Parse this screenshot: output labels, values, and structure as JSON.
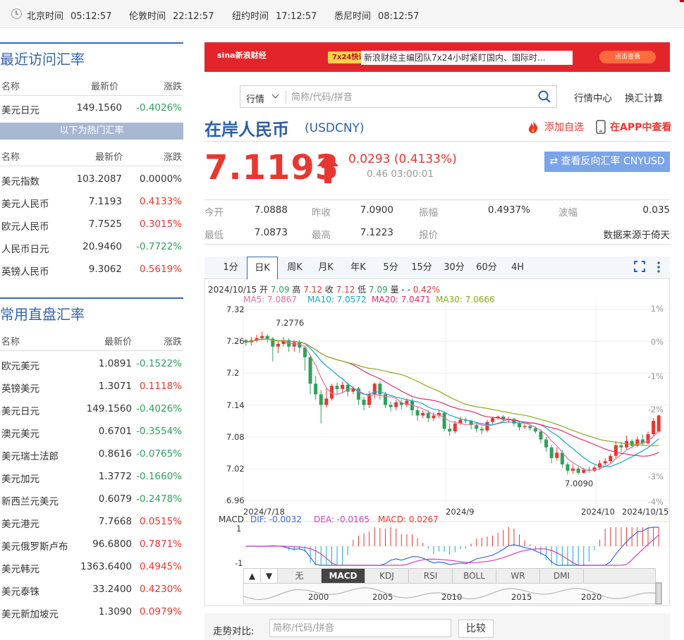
{
  "clocks": [
    {
      "label": "北京时间",
      "time": "05:12:57"
    },
    {
      "label": "伦敦时间",
      "time": "22:12:57"
    },
    {
      "label": "纽约时间",
      "time": "17:12:57"
    },
    {
      "label": "悉尼时间",
      "time": "08:12:57"
    }
  ],
  "recent": {
    "title": "最近访问汇率",
    "headers": [
      "名称",
      "最新价",
      "涨跌"
    ],
    "rows": [
      {
        "name": "美元日元",
        "price": "149.1560",
        "chg": "-0.4026%"
      }
    ]
  },
  "hot": {
    "bar": "以下为热门汇率",
    "headers": [
      "名称",
      "最新价",
      "涨跌"
    ],
    "rows": [
      {
        "name": "美元指数",
        "price": "103.2087",
        "chg": "0.0000%"
      },
      {
        "name": "美元人民币",
        "price": "7.1193",
        "chg": "0.4133%"
      },
      {
        "name": "欧元人民币",
        "price": "7.7525",
        "chg": "0.3015%"
      },
      {
        "name": "人民币日元",
        "price": "20.9460",
        "chg": "-0.7722%"
      },
      {
        "name": "英镑人民币",
        "price": "9.3062",
        "chg": "0.5619%"
      }
    ]
  },
  "direct": {
    "title": "常用直盘汇率",
    "headers": [
      "名称",
      "最新价",
      "涨跌"
    ],
    "rows": [
      {
        "name": "欧元美元",
        "price": "1.0891",
        "chg": "-0.1522%"
      },
      {
        "name": "英镑美元",
        "price": "1.3071",
        "chg": "0.1118%"
      },
      {
        "name": "美元日元",
        "price": "149.1560",
        "chg": "-0.4026%"
      },
      {
        "name": "澳元美元",
        "price": "0.6701",
        "chg": "-0.3554%"
      },
      {
        "name": "美元瑞士法郎",
        "price": "0.8616",
        "chg": "-0.0765%"
      },
      {
        "name": "美元加元",
        "price": "1.3772",
        "chg": "-0.1660%"
      },
      {
        "name": "新西兰元美元",
        "price": "0.6079",
        "chg": "-0.2478%"
      },
      {
        "name": "美元港元",
        "price": "7.7668",
        "chg": "0.0515%"
      },
      {
        "name": "美元俄罗斯卢布",
        "price": "96.6800",
        "chg": "0.7871%"
      },
      {
        "name": "美元韩元",
        "price": "1363.6400",
        "chg": "0.4945%"
      },
      {
        "name": "美元泰铢",
        "price": "33.2400",
        "chg": "0.4230%"
      },
      {
        "name": "美元新加坡元",
        "price": "1.3090",
        "chg": "0.0979%"
      }
    ]
  },
  "banner": {
    "logo": "sina新浪财经",
    "tag": "7x24快讯",
    "msg": "新浪财经主编团队7x24小时紧盯国内、国际时...",
    "button": "点击查看"
  },
  "search": {
    "select": "行情",
    "placeholder": "简称/代码/拼音"
  },
  "links": {
    "center": "行情中心",
    "calc": "换汇计算"
  },
  "currency": {
    "name": "在岸人民币",
    "code": "(USDCNY)",
    "add_fav": "添加自选",
    "app_view": "在APP中查看",
    "price": "7.1193",
    "change": "0.0293 (0.4133%)",
    "meta": "0.46 03:00:01",
    "reverse_btn": "查看反向汇率 CNYUSD",
    "accent": "#e8372f",
    "brand": "#2d5fa8"
  },
  "stats": [
    {
      "label": "今开",
      "value": "7.0888"
    },
    {
      "label": "昨收",
      "value": "7.0900"
    },
    {
      "label": "振幅",
      "value": "0.4937%"
    },
    {
      "label": "波幅",
      "value": "0.035"
    },
    {
      "label": "最低",
      "value": "7.0873"
    },
    {
      "label": "最高",
      "value": "7.1223"
    },
    {
      "label": "报价",
      "value": ""
    },
    {
      "label": "",
      "value": "数据来源于倚天"
    }
  ],
  "tabs": [
    "1分",
    "日K",
    "周K",
    "月K",
    "年K",
    "5分",
    "15分",
    "30分",
    "60分",
    "4H"
  ],
  "active_tab": "日K",
  "ohlc": {
    "date": "2024/10/15",
    "open_l": "开",
    "open": "7.09",
    "high_l": "高",
    "high": "7.12",
    "close_l": "收",
    "close": "7.12",
    "low_l": "低",
    "low": "7.09",
    "vol_l": "量",
    "vol": "-",
    "pct": "0.42%"
  },
  "ma": [
    {
      "text": "MA5: 7.0867",
      "color": "#e070a8"
    },
    {
      "text": "MA10: 7.0572",
      "color": "#18a8c8"
    },
    {
      "text": "MA20: 7.0471",
      "color": "#e0306a"
    },
    {
      "text": "MA30: 7.0666",
      "color": "#8aac1c"
    }
  ],
  "macd": {
    "title": "MACD",
    "dif": "DIF: -0.0032",
    "dea": "DEA: -0.0165",
    "macd": "MACD: 0.0267",
    "y_top": "1",
    "y_bot": "-1"
  },
  "ind_tabs": [
    "无",
    "MACD",
    "KDJ",
    "RSI",
    "BOLL",
    "WR",
    "DMI"
  ],
  "nav_years": [
    "2000",
    "2005",
    "2010",
    "2015",
    "2020"
  ],
  "compare": {
    "label": "走势对比:",
    "placeholder": "简称/代码/拼音",
    "button": "比较"
  },
  "chart_data": {
    "type": "candlestick",
    "y_ticks": [
      "7.32",
      "7.26",
      "7.2",
      "7.14",
      "7.08",
      "7.02",
      "6.96"
    ],
    "ylim": [
      6.96,
      7.32
    ],
    "pct_ticks": [
      "1%",
      "0%",
      "-1%",
      "-2%",
      "-3%",
      "-4%"
    ],
    "x_ticks": [
      "2024/7/18",
      "2024/9",
      "2024/10",
      "2024/10/15"
    ],
    "annot_high": "7.2776",
    "annot_low": "7.0090",
    "candles": [
      [
        7.262,
        7.258,
        7.265,
        7.252
      ],
      [
        7.258,
        7.262,
        7.268,
        7.252
      ],
      [
        7.262,
        7.266,
        7.272,
        7.258
      ],
      [
        7.266,
        7.27,
        7.278,
        7.262
      ],
      [
        7.27,
        7.265,
        7.273,
        7.258
      ],
      [
        7.265,
        7.25,
        7.268,
        7.222
      ],
      [
        7.25,
        7.255,
        7.262,
        7.238
      ],
      [
        7.255,
        7.262,
        7.268,
        7.25
      ],
      [
        7.262,
        7.25,
        7.266,
        7.24
      ],
      [
        7.25,
        7.258,
        7.262,
        7.24
      ],
      [
        7.258,
        7.248,
        7.262,
        7.238
      ],
      [
        7.248,
        7.23,
        7.252,
        7.205
      ],
      [
        7.23,
        7.18,
        7.235,
        7.16
      ],
      [
        7.18,
        7.16,
        7.195,
        7.15
      ],
      [
        7.16,
        7.14,
        7.168,
        7.105
      ],
      [
        7.14,
        7.152,
        7.172,
        7.135
      ],
      [
        7.152,
        7.176,
        7.18,
        7.148
      ],
      [
        7.176,
        7.17,
        7.182,
        7.16
      ],
      [
        7.17,
        7.178,
        7.184,
        7.162
      ],
      [
        7.178,
        7.165,
        7.182,
        7.156
      ],
      [
        7.165,
        7.171,
        7.175,
        7.16
      ],
      [
        7.171,
        7.15,
        7.174,
        7.14
      ],
      [
        7.15,
        7.14,
        7.155,
        7.13
      ],
      [
        7.14,
        7.16,
        7.166,
        7.134
      ],
      [
        7.16,
        7.18,
        7.182,
        7.152
      ],
      [
        7.18,
        7.16,
        7.184,
        7.15
      ],
      [
        7.16,
        7.14,
        7.165,
        7.134
      ],
      [
        7.14,
        7.136,
        7.146,
        7.128
      ],
      [
        7.136,
        7.145,
        7.15,
        7.13
      ],
      [
        7.145,
        7.14,
        7.15,
        7.132
      ],
      [
        7.14,
        7.148,
        7.153,
        7.136
      ],
      [
        7.148,
        7.13,
        7.152,
        7.12
      ],
      [
        7.13,
        7.12,
        7.136,
        7.11
      ],
      [
        7.12,
        7.125,
        7.13,
        7.115
      ],
      [
        7.125,
        7.115,
        7.13,
        7.108
      ],
      [
        7.115,
        7.12,
        7.126,
        7.11
      ],
      [
        7.12,
        7.125,
        7.13,
        7.115
      ],
      [
        7.125,
        7.095,
        7.128,
        7.09
      ],
      [
        7.095,
        7.09,
        7.105,
        7.082
      ],
      [
        7.09,
        7.105,
        7.11,
        7.086
      ],
      [
        7.105,
        7.112,
        7.118,
        7.102
      ],
      [
        7.112,
        7.11,
        7.116,
        7.105
      ],
      [
        7.11,
        7.102,
        7.112,
        7.094
      ],
      [
        7.102,
        7.095,
        7.108,
        7.088
      ],
      [
        7.095,
        7.092,
        7.1,
        7.085
      ],
      [
        7.092,
        7.108,
        7.112,
        7.088
      ],
      [
        7.108,
        7.115,
        7.118,
        7.102
      ],
      [
        7.115,
        7.118,
        7.12,
        7.112
      ],
      [
        7.118,
        7.112,
        7.121,
        7.108
      ],
      [
        7.112,
        7.114,
        7.118,
        7.106
      ],
      [
        7.114,
        7.105,
        7.116,
        7.1
      ],
      [
        7.105,
        7.098,
        7.11,
        7.092
      ],
      [
        7.098,
        7.1,
        7.104,
        7.095
      ],
      [
        7.1,
        7.096,
        7.104,
        7.092
      ],
      [
        7.096,
        7.09,
        7.1,
        7.086
      ],
      [
        7.09,
        7.075,
        7.094,
        7.068
      ],
      [
        7.075,
        7.06,
        7.08,
        7.052
      ],
      [
        7.06,
        7.04,
        7.065,
        7.03
      ],
      [
        7.04,
        7.05,
        7.06,
        7.035
      ],
      [
        7.05,
        7.028,
        7.055,
        7.022
      ],
      [
        7.028,
        7.016,
        7.032,
        7.009
      ],
      [
        7.016,
        7.02,
        7.028,
        7.01
      ],
      [
        7.02,
        7.012,
        7.024,
        7.009
      ],
      [
        7.012,
        7.018,
        7.022,
        7.01
      ],
      [
        7.018,
        7.016,
        7.024,
        7.012
      ],
      [
        7.016,
        7.022,
        7.026,
        7.014
      ],
      [
        7.022,
        7.03,
        7.036,
        7.018
      ],
      [
        7.03,
        7.034,
        7.04,
        7.026
      ],
      [
        7.034,
        7.044,
        7.048,
        7.03
      ],
      [
        7.044,
        7.064,
        7.072,
        7.04
      ],
      [
        7.064,
        7.06,
        7.07,
        7.05
      ],
      [
        7.06,
        7.072,
        7.082,
        7.056
      ],
      [
        7.072,
        7.063,
        7.076,
        7.058
      ],
      [
        7.063,
        7.075,
        7.08,
        7.06
      ],
      [
        7.075,
        7.068,
        7.084,
        7.064
      ],
      [
        7.068,
        7.085,
        7.09,
        7.065
      ],
      [
        7.085,
        7.11,
        7.115,
        7.082
      ],
      [
        7.09,
        7.12,
        7.122,
        7.087
      ]
    ]
  }
}
